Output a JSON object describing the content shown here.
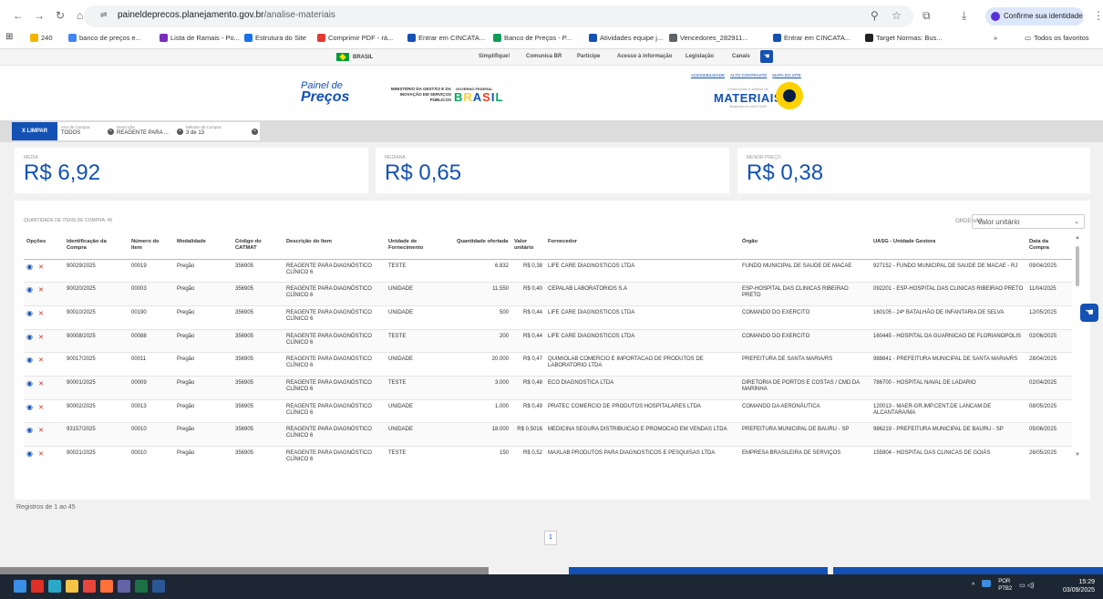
{
  "browser": {
    "url_host": "paineldeprecos.planejamento.gov.br",
    "url_path": "/analise-materiais",
    "identity_label": "Confirme sua identidade",
    "bookmarks": [
      {
        "label": "240",
        "color": "#f4b400"
      },
      {
        "label": "banco de preços e...",
        "color": "#4285f4"
      },
      {
        "label": "Lista de Ramais - Po...",
        "color": "#7b2cbf"
      },
      {
        "label": "Estrutura do Site",
        "color": "#1a73e8"
      },
      {
        "label": "Comprimir PDF - rá...",
        "color": "#e53935"
      },
      {
        "label": "Entrar em CINCATA...",
        "color": "#1351b4"
      },
      {
        "label": "Banco de Preços - P...",
        "color": "#0f9d58"
      },
      {
        "label": "Atividades equipe j...",
        "color": "#1351b4"
      },
      {
        "label": "Vencedores_282911...",
        "color": "#5f6368"
      },
      {
        "label": "Entrar em CINCATA...",
        "color": "#1351b4"
      },
      {
        "label": "Target Normas: Bus...",
        "color": "#222222"
      }
    ],
    "more_bookmarks": "»",
    "all_favorites": "Todos os favoritos"
  },
  "govbar": {
    "brasil": "BRASIL",
    "links": [
      "Simplifique!",
      "Comunica BR",
      "Participe",
      "Acesso à informação",
      "Legislação",
      "Canais"
    ]
  },
  "header": {
    "painel_line1": "Painel de",
    "painel_line2": "Preços",
    "ministerio": "MINISTÉRIO DA GESTÃO E DA INOVAÇÃO EM SERVIÇOS PÚBLICOS",
    "gov_federal": "GOVERNO FEDERAL",
    "brasil_logo": [
      "B",
      "R",
      "A",
      "S",
      "I",
      "L"
    ],
    "acess_links": [
      "ACESSIBILIDADE",
      "ALTO CONTRASTE",
      "MAPA DO SITE"
    ],
    "materiais_sub": "Informações e análise de",
    "materiais_title": "MATERIAIS",
    "materiais_upd": "Atualizado em 04/07/2025"
  },
  "filters": {
    "limpar": "X LIMPAR",
    "chips": [
      {
        "label": "Ano da Compra",
        "value": "TODOS"
      },
      {
        "label": "Descrição",
        "value": "REAGENTE PARA ..."
      },
      {
        "label": "Método da Compra",
        "value": "3 de 13"
      }
    ]
  },
  "stats": [
    {
      "label": "MÉDIA",
      "value": "R$ 6,92"
    },
    {
      "label": "MEDIANA",
      "value": "R$ 0,65"
    },
    {
      "label": "MENOR PREÇO",
      "value": "R$ 0,38"
    }
  ],
  "table": {
    "quantity_label": "QUANTIDADE DE ITENS DE COMPRA: 45",
    "order_label": "ORDENAR",
    "order_value": "Valor unitário",
    "headers": [
      "Opções",
      "Identificação da Compra",
      "Número do Item",
      "Modalidade",
      "Código do CATMAT",
      "Descrição do Item",
      "Unidade de Fornecimento",
      "Quantidade ofertada",
      "Valor unitário",
      "Fornecedor",
      "Órgão",
      "UASG - Unidade Gestora",
      "Data da Compra"
    ],
    "rows": [
      [
        "90029/2025",
        "00019",
        "Pregão",
        "356905",
        "REAGENTE PARA DIAGNÓSTICO CLÍNICO 6",
        "TESTE",
        "6.832",
        "R$ 0,38",
        "LIFE CARE DIAGNOSTICOS LTDA",
        "FUNDO MUNICIPAL DE SAUDE DE MACAE",
        "927152 - FUNDO MUNICIPAL DE SAUDE DE MACAE - RJ",
        "09/04/2025"
      ],
      [
        "90020/2025",
        "00003",
        "Pregão",
        "356905",
        "REAGENTE PARA DIAGNÓSTICO CLÍNICO 6",
        "UNIDADE",
        "11.550",
        "R$ 0,40",
        "CEPALAB LABORATORIOS S.A",
        "ESP-HOSPITAL DAS CLINICAS RIBEIRAO PRETO",
        "092201 - ESP-HOSPITAL DAS CLINICAS RIBEIRAO PRETO",
        "11/04/2025"
      ],
      [
        "90010/2025",
        "00190",
        "Pregão",
        "356905",
        "REAGENTE PARA DIAGNÓSTICO CLÍNICO 6",
        "UNIDADE",
        "500",
        "R$ 0,44",
        "LIFE CARE DIAGNOSTICOS LTDA",
        "COMANDO DO EXERCITO",
        "160105 - 24º BATALHÃO DE INFANTARIA DE SELVA",
        "12/05/2025"
      ],
      [
        "90008/2025",
        "00088",
        "Pregão",
        "356905",
        "REAGENTE PARA DIAGNÓSTICO CLÍNICO 6",
        "TESTE",
        "200",
        "R$ 0,44",
        "LIFE CARE DIAGNOSTICOS LTDA",
        "COMANDO DO EXERCITO",
        "160445 - HOSPITAL DA GUARNICAO DE FLORIANOPOLIS",
        "02/06/2025"
      ],
      [
        "90017/2025",
        "00011",
        "Pregão",
        "356905",
        "REAGENTE PARA DIAGNÓSTICO CLÍNICO 6",
        "UNIDADE",
        "20.000",
        "R$ 0,47",
        "QUIMIOLAB COMERCIO E IMPORTACAO DE PRODUTOS DE LABORATORIO LTDA",
        "PREFEITURA DE SANTA MARIA/RS",
        "988841 - PREFEITURA MUNICIPAL DE SANTA MARIA/RS",
        "28/04/2025"
      ],
      [
        "90001/2025",
        "00009",
        "Pregão",
        "356905",
        "REAGENTE PARA DIAGNÓSTICO CLÍNICO 6",
        "TESTE",
        "3.000",
        "R$ 0,48",
        "ECO DIAGNOSTICA LTDA",
        "DIRETORIA DE PORTOS E COSTAS / CMD DA MARINHA",
        "786700 - HOSPITAL NAVAL DE LADARIO",
        "02/04/2025"
      ],
      [
        "90002/2025",
        "00013",
        "Pregão",
        "356905",
        "REAGENTE PARA DIAGNÓSTICO CLÍNICO 6",
        "UNIDADE",
        "1.000",
        "R$ 0,49",
        "PRATEC COMERCIO DE PRODUTOS HOSPITALARES LTDA",
        "COMANDO DA AERONÁUTICA",
        "120013 - MAER-GR.IMP.CENT.DE LANCAM.DE ALCANTARA/MA",
        "08/05/2025"
      ],
      [
        "93157/2025",
        "00010",
        "Pregão",
        "356905",
        "REAGENTE PARA DIAGNÓSTICO CLÍNICO 6",
        "UNIDADE",
        "18.000",
        "R$ 0,5016",
        "MEDICINA SEGURA DISTRIBUICAO E PROMOCAO EM VENDAS LTDA",
        "PREFEITURA MUNICIPAL DE BAURU - SP",
        "986219 - PREFEITURA MUNICIPAL DE BAURU - SP",
        "05/06/2025"
      ],
      [
        "90021/2025",
        "00010",
        "Pregão",
        "356905",
        "REAGENTE PARA DIAGNÓSTICO CLÍNICO 6",
        "TESTE",
        "150",
        "R$ 0,52",
        "MAXLAB PRODUTOS PARA DIAGNOSTICOS E PESQUISAS LTDA",
        "EMPRESA BRASILEIRA DE SERVIÇOS",
        "155904 - HOSPITAL DAS CLINICAS DE GOIÁS",
        "26/05/2025"
      ]
    ],
    "registros": "Registros de 1 ao 45",
    "page": "1"
  },
  "taskbar": {
    "lang1": "POR",
    "lang2": "PTB2",
    "time": "15:29",
    "date": "03/09/2025",
    "apps": [
      {
        "name": "windows-start-icon",
        "color": "#3a8ee6"
      },
      {
        "name": "acrobat-icon",
        "color": "#e02f26"
      },
      {
        "name": "edge-icon",
        "color": "#2ba8c8"
      },
      {
        "name": "explorer-icon",
        "color": "#f6c445"
      },
      {
        "name": "chrome-icon",
        "color": "#e8453c"
      },
      {
        "name": "firefox-icon",
        "color": "#ff7139"
      },
      {
        "name": "teams-icon",
        "color": "#6264a7"
      },
      {
        "name": "excel-icon",
        "color": "#1d7044"
      },
      {
        "name": "word-icon",
        "color": "#2b5797"
      }
    ]
  }
}
